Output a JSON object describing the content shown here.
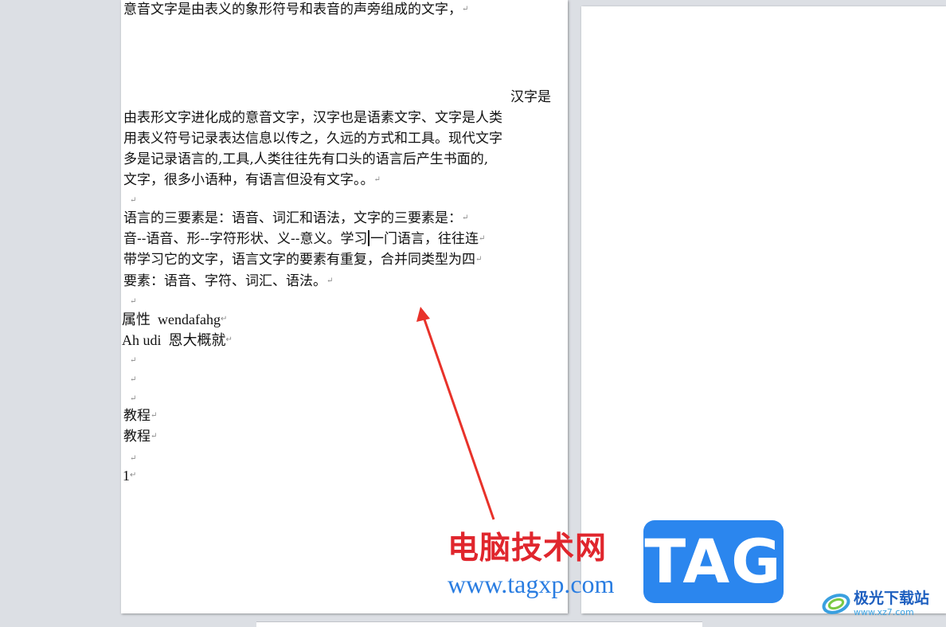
{
  "document": {
    "lines": [
      {
        "text": "意音文字是由表义的象形符号和表音的声旁组成的文字，",
        "mark": "↵"
      },
      {
        "text": "汉字是",
        "mark": ""
      },
      {
        "text": "由表形文字进化成的意音文字，汉字也是语素文字、文字是人类",
        "mark": ""
      },
      {
        "text": "用表义符号记录表达信息以传之，久远的方式和工具。现代文字",
        "mark": ""
      },
      {
        "text": "多是记录语言的,工具,人类往往先有口头的语言后产生书面的,",
        "mark": ""
      },
      {
        "text": "文字，很多小语种，有语言但没有文字。。",
        "mark": "↵"
      },
      {
        "text": "",
        "mark": "↵"
      },
      {
        "text": "语言的三要素是：语音、词汇和语法，文字的三要素是：",
        "mark": "↵"
      },
      {
        "text_before_caret": "音--语音、形--字符形状、义--意义。学习",
        "text_after_caret": "一门语言，往往连",
        "mark": "↵"
      },
      {
        "text": "带学习它的文字，语言文字的要素有重复，合并同类型为四",
        "mark": "↵"
      },
      {
        "text": "要素：语音、字符、词汇、语法。",
        "mark": "↵"
      },
      {
        "text": "",
        "mark": "↵"
      },
      {
        "text": "属性  wendafahg",
        "mark": "↵"
      },
      {
        "text": "Ah udi  恩大概就",
        "mark": "↵"
      },
      {
        "text": "",
        "mark": "↵"
      },
      {
        "text": "",
        "mark": "↵"
      },
      {
        "text": "",
        "mark": "↵"
      },
      {
        "text": "教程",
        "mark": "↵"
      },
      {
        "text": "教程",
        "mark": "↵"
      },
      {
        "text": "",
        "mark": "↵"
      },
      {
        "text": "1",
        "mark": "↵"
      }
    ]
  },
  "watermark": {
    "title": "电脑技术网",
    "url": "www.tagxp.com",
    "tag": "TAG",
    "site2_title": "极光下载站",
    "site2_url": "www.xz7.com"
  },
  "colors": {
    "arrow": "#e8322a",
    "accent_blue": "#2b86ee",
    "accent_red": "#e0262d"
  }
}
